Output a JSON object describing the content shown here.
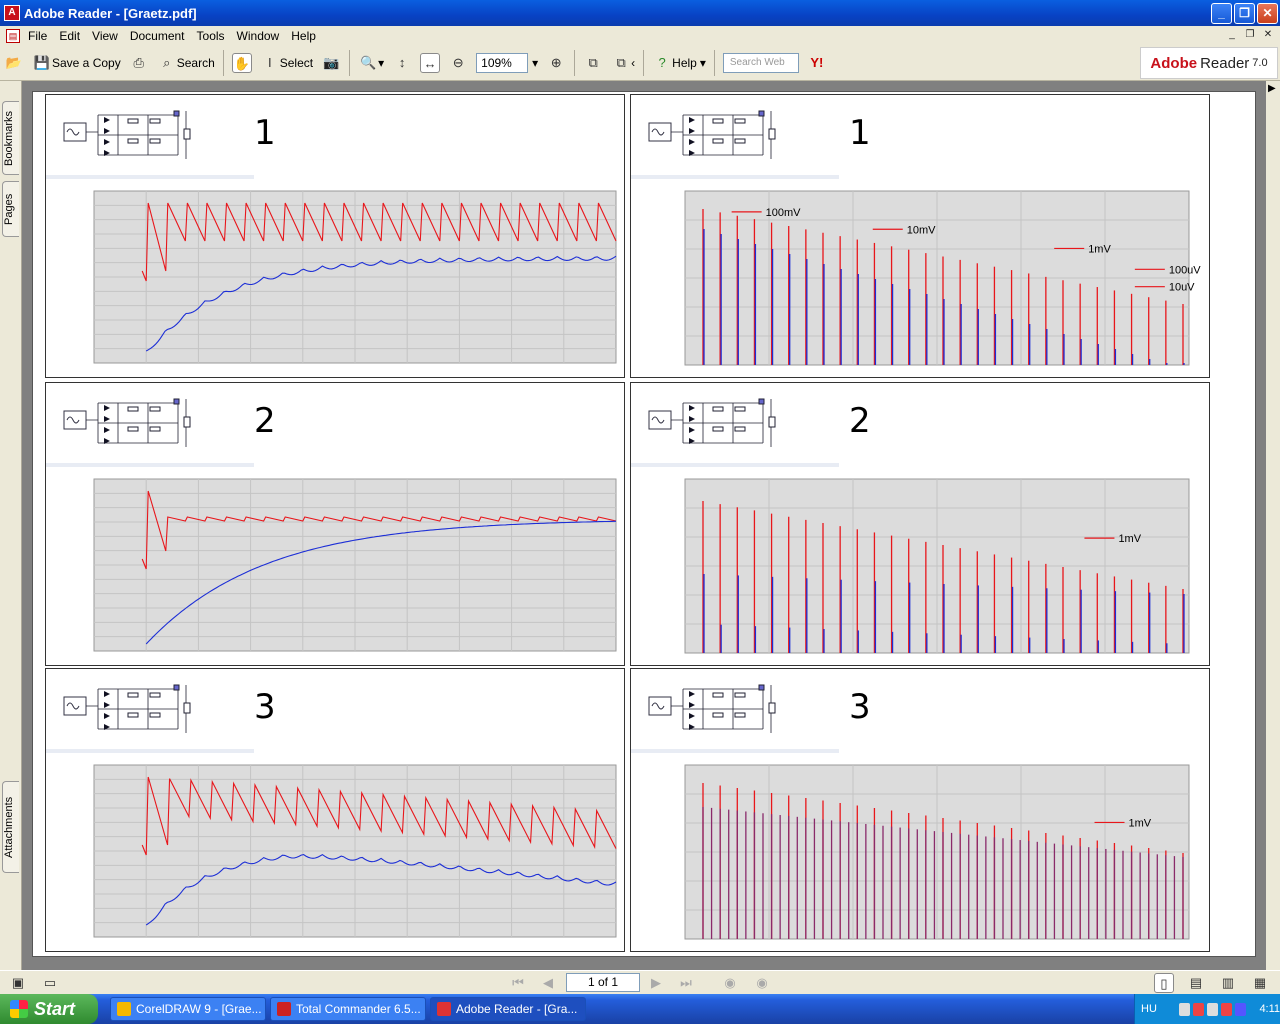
{
  "window": {
    "title": "Adobe Reader - [Graetz.pdf]"
  },
  "menu": [
    "File",
    "Edit",
    "View",
    "Document",
    "Tools",
    "Window",
    "Help"
  ],
  "toolbar": {
    "save_copy": "Save a Copy",
    "search": "Search",
    "select": "Select",
    "zoom": "109%",
    "help": "Help",
    "search_web_placeholder": "Search Web",
    "brand": "Adobe",
    "product": "Reader",
    "version": "7.0"
  },
  "nav_tabs": {
    "bookmarks": "Bookmarks",
    "pages": "Pages",
    "attachments": "Attachments"
  },
  "document": {
    "panels": [
      {
        "label": "1",
        "kind": "time",
        "annotations": []
      },
      {
        "label": "1",
        "kind": "spectrum",
        "annotations": [
          "100mV",
          "10mV",
          "1mV",
          "100uV",
          "10uV"
        ]
      },
      {
        "label": "2",
        "kind": "time",
        "annotations": []
      },
      {
        "label": "2",
        "kind": "spectrum",
        "annotations": [
          "1mV"
        ]
      },
      {
        "label": "3",
        "kind": "time",
        "annotations": []
      },
      {
        "label": "3",
        "kind": "spectrum",
        "annotations": [
          "1mV"
        ]
      }
    ],
    "colors": {
      "ripple": "#e8161b",
      "smoothed": "#1d2fd6",
      "plot_bg": "#dcdcdc"
    }
  },
  "statusbar": {
    "page_indicator": "1 of 1"
  },
  "taskbar": {
    "start": "Start",
    "tasks": [
      "CorelDRAW 9 - [Grae...",
      "Total Commander 6.5...",
      "Adobe Reader - [Gra..."
    ],
    "language": "HU",
    "clock": "4:11"
  }
}
